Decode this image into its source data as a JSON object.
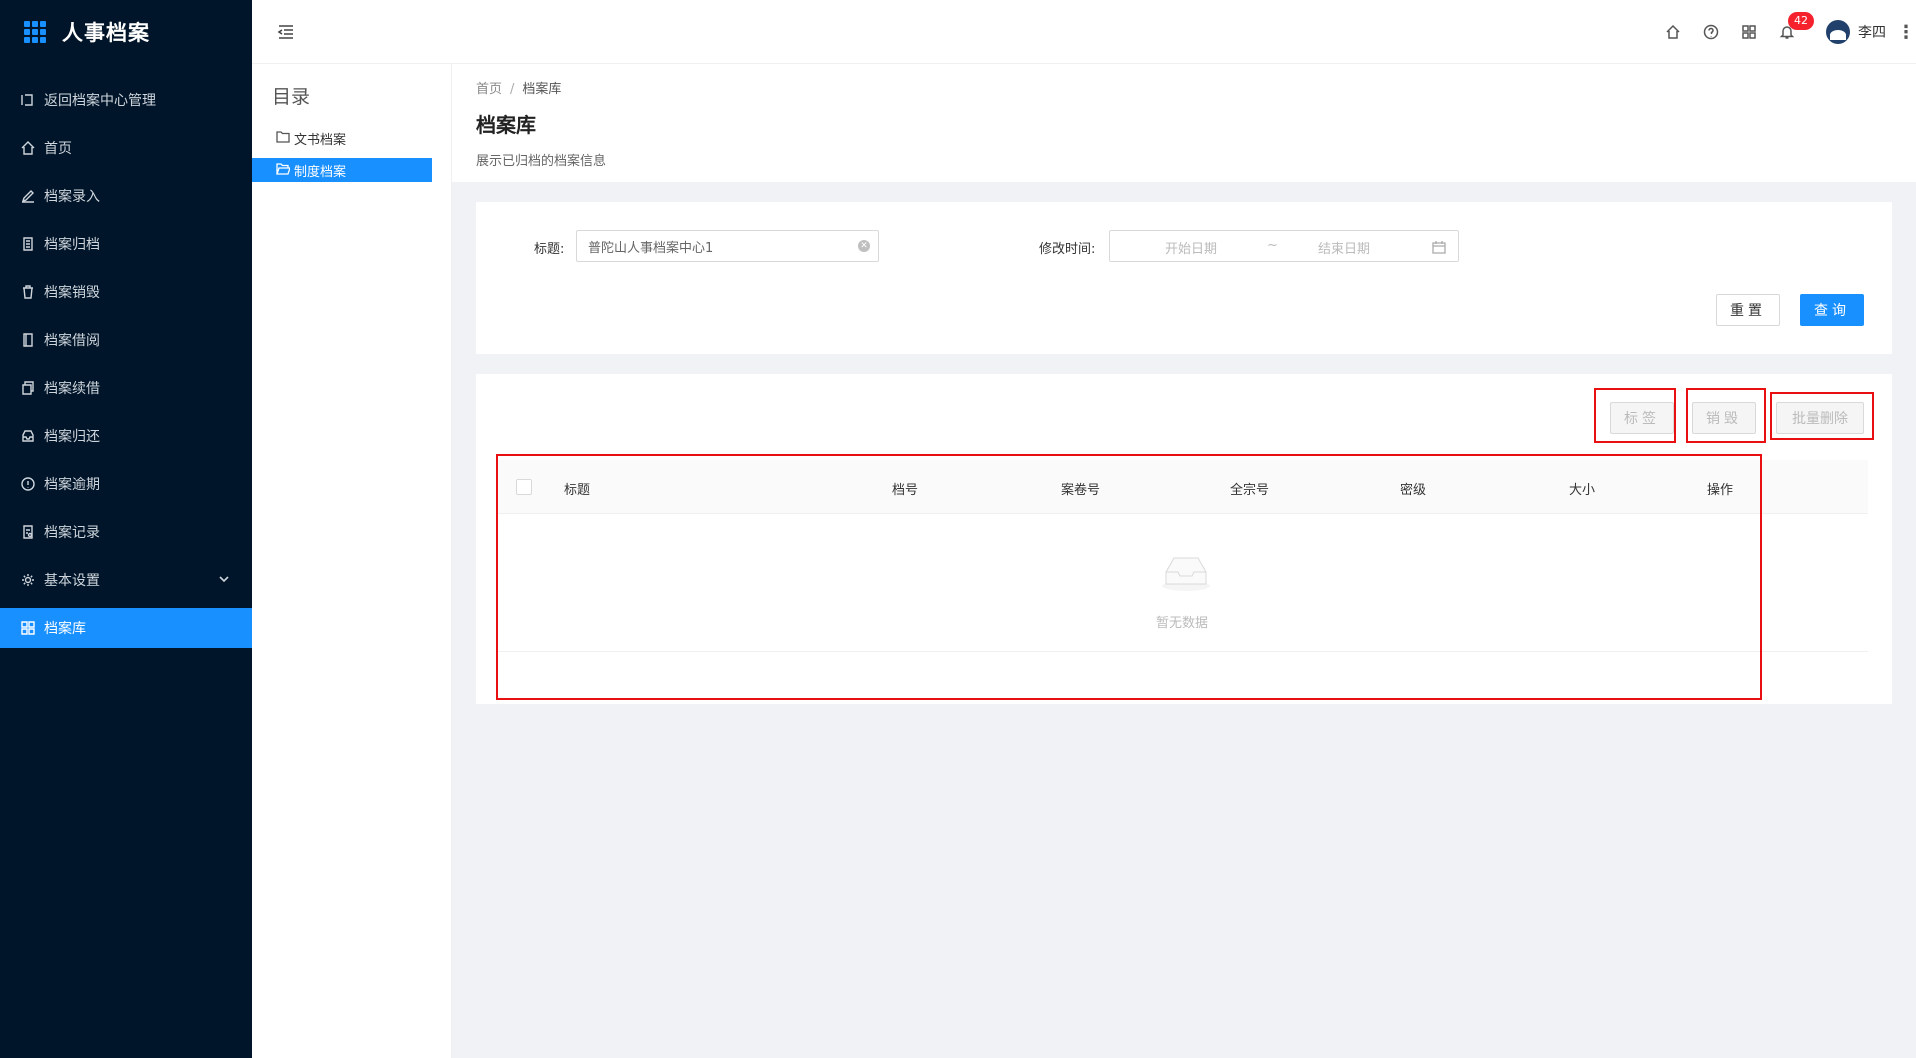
{
  "app": {
    "title": "人事档案"
  },
  "sidebar": {
    "items": [
      {
        "label": "返回档案中心管理",
        "icon": "return-icon"
      },
      {
        "label": "首页",
        "icon": "home-icon"
      },
      {
        "label": "档案录入",
        "icon": "edit-icon"
      },
      {
        "label": "档案归档",
        "icon": "file-icon"
      },
      {
        "label": "档案销毁",
        "icon": "trash-icon"
      },
      {
        "label": "档案借阅",
        "icon": "book-icon"
      },
      {
        "label": "档案续借",
        "icon": "copy-icon"
      },
      {
        "label": "档案归还",
        "icon": "inbox-icon"
      },
      {
        "label": "档案逾期",
        "icon": "alert-icon"
      },
      {
        "label": "档案记录",
        "icon": "record-icon"
      },
      {
        "label": "基本设置",
        "icon": "gear-icon"
      },
      {
        "label": "档案库",
        "icon": "grid-icon",
        "active": true
      }
    ]
  },
  "header": {
    "notification_count": "42",
    "username": "李四"
  },
  "tree": {
    "title": "目录",
    "nodes": [
      {
        "label": "文书档案"
      },
      {
        "label": "制度档案",
        "selected": true
      }
    ]
  },
  "page": {
    "breadcrumb": [
      "首页",
      "档案库"
    ],
    "title": "档案库",
    "description": "展示已归档的档案信息"
  },
  "search": {
    "title_label": "标题:",
    "title_value": "普陀山人事档案中心1",
    "time_label": "修改时间:",
    "start_placeholder": "开始日期",
    "range_sep": "~",
    "end_placeholder": "结束日期",
    "reset_label": "重置",
    "query_label": "查询"
  },
  "toolbar": {
    "tag_label": "标签",
    "destroy_label": "销毁",
    "batch_delete_label": "批量删除"
  },
  "table": {
    "columns": [
      "标题",
      "档号",
      "案卷号",
      "全宗号",
      "密级",
      "大小",
      "操作"
    ],
    "empty_text": "暂无数据"
  },
  "colors": {
    "accent": "#1890ff",
    "sidebar_bg": "#001529",
    "highlight": "#e81010",
    "badge": "#f5222d"
  }
}
